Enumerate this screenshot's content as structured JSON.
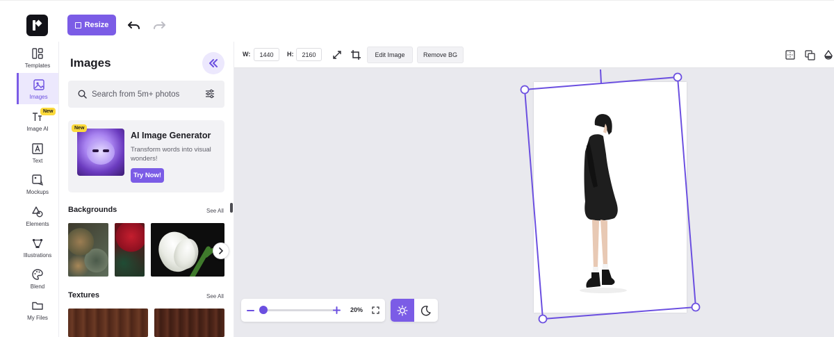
{
  "topbar": {
    "resize_label": "Resize"
  },
  "rail": {
    "items": [
      {
        "label": "Templates",
        "icon": "templates-icon"
      },
      {
        "label": "Images",
        "icon": "image-icon",
        "active": true
      },
      {
        "label": "Image AI",
        "icon": "image-ai-icon",
        "badge": "New"
      },
      {
        "label": "Text",
        "icon": "text-icon"
      },
      {
        "label": "Mockups",
        "icon": "mockup-icon"
      },
      {
        "label": "Elements",
        "icon": "shapes-icon"
      },
      {
        "label": "Illustrations",
        "icon": "illustration-icon"
      },
      {
        "label": "Blend",
        "icon": "palette-icon"
      },
      {
        "label": "My Files",
        "icon": "folder-icon"
      }
    ]
  },
  "panel": {
    "title": "Images",
    "search_placeholder": "Search from 5m+ photos",
    "ai_card": {
      "badge": "New",
      "title": "AI Image Generator",
      "description": "Transform words into visual wonders!",
      "button": "Try Now!"
    },
    "backgrounds": {
      "title": "Backgrounds",
      "see_all": "See All"
    },
    "textures": {
      "title": "Textures",
      "see_all": "See All"
    }
  },
  "toolbar": {
    "width_label": "W:",
    "width_value": "1440",
    "height_label": "H:",
    "height_value": "2160",
    "edit_image": "Edit Image",
    "remove_bg": "Remove BG"
  },
  "zoom": {
    "percent": "20%",
    "level": 0.2
  },
  "colors": {
    "accent": "#7b5ce6",
    "accent_light": "#ece8fd",
    "badge": "#fbd93b",
    "canvas_bg": "#e9e9ee"
  }
}
